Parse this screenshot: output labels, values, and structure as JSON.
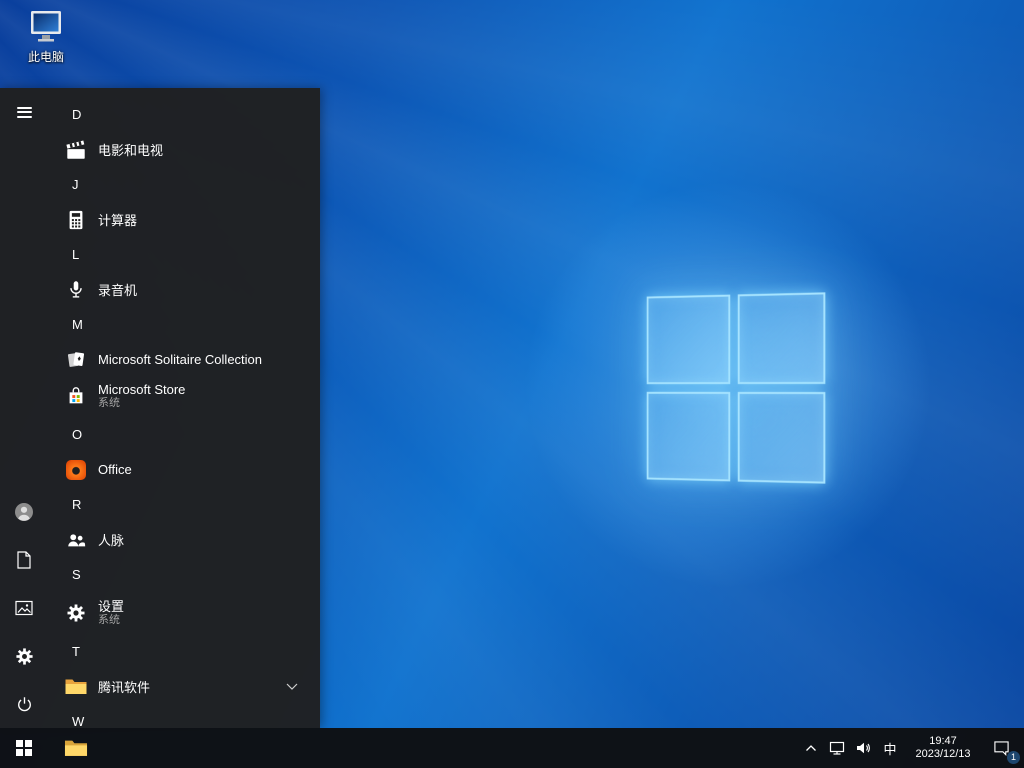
{
  "desktop": {
    "icons": [
      {
        "label": "此电脑",
        "icon": "this-pc-icon"
      }
    ],
    "wallpaper_logo": "windows-logo"
  },
  "start_menu": {
    "rail": {
      "top": [
        {
          "name": "expand-menu",
          "icon": "hamburger-icon"
        }
      ],
      "bottom": [
        {
          "name": "account",
          "icon": "user-icon"
        },
        {
          "name": "documents",
          "icon": "document-icon"
        },
        {
          "name": "pictures",
          "icon": "picture-icon"
        },
        {
          "name": "settings",
          "icon": "gear-icon"
        },
        {
          "name": "power",
          "icon": "power-icon"
        }
      ]
    },
    "sections": [
      {
        "letter": "D",
        "apps": [
          {
            "label": "电影和电视",
            "icon": "movies-tv-icon"
          }
        ]
      },
      {
        "letter": "J",
        "apps": [
          {
            "label": "计算器",
            "icon": "calculator-icon"
          }
        ]
      },
      {
        "letter": "L",
        "apps": [
          {
            "label": "录音机",
            "icon": "voice-recorder-icon"
          }
        ]
      },
      {
        "letter": "M",
        "apps": [
          {
            "label": "Microsoft Solitaire Collection",
            "icon": "solitaire-cards-icon"
          },
          {
            "label": "Microsoft Store",
            "sublabel": "系统",
            "icon": "store-bag-icon"
          }
        ]
      },
      {
        "letter": "O",
        "apps": [
          {
            "label": "Office",
            "icon": "office-logo-icon"
          }
        ]
      },
      {
        "letter": "R",
        "apps": [
          {
            "label": "人脉",
            "icon": "people-icon"
          }
        ]
      },
      {
        "letter": "S",
        "apps": [
          {
            "label": "设置",
            "sublabel": "系统",
            "icon": "gear-icon"
          }
        ]
      },
      {
        "letter": "T",
        "apps": [
          {
            "label": "腾讯软件",
            "icon": "folder-icon",
            "expandable": true
          }
        ]
      },
      {
        "letter": "W",
        "apps": []
      }
    ]
  },
  "taskbar": {
    "start": {
      "name": "start-button",
      "icon": "windows-logo-icon"
    },
    "pinned": [
      {
        "name": "file-explorer",
        "icon": "folder-icon"
      }
    ],
    "tray": {
      "ime": "中",
      "time": "19:47",
      "date": "2023/12/13",
      "notification_badge": "1",
      "icons": [
        "chevron-up-icon",
        "network-icon",
        "speaker-icon",
        "notification-icon"
      ]
    }
  },
  "colors": {
    "accent": "#0078d7",
    "menu_bg": "#202020",
    "taskbar_bg": "#0e1013",
    "desktop_blue": "#1173cf",
    "folder_yellow": "#ffd869",
    "office_orange": "#d83b01"
  }
}
